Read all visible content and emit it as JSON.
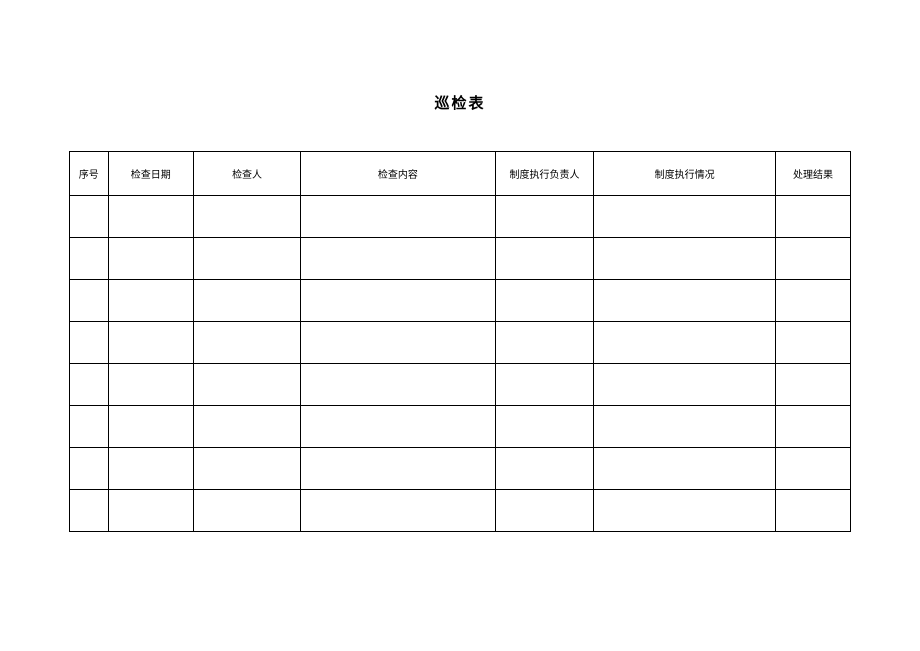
{
  "title": "巡检表",
  "columns": [
    "序号",
    "检查日期",
    "检查人",
    "检查内容",
    "制度执行负责人",
    "制度执行情况",
    "处理结果"
  ],
  "rows": [
    [
      "",
      "",
      "",
      "",
      "",
      "",
      ""
    ],
    [
      "",
      "",
      "",
      "",
      "",
      "",
      ""
    ],
    [
      "",
      "",
      "",
      "",
      "",
      "",
      ""
    ],
    [
      "",
      "",
      "",
      "",
      "",
      "",
      ""
    ],
    [
      "",
      "",
      "",
      "",
      "",
      "",
      ""
    ],
    [
      "",
      "",
      "",
      "",
      "",
      "",
      ""
    ],
    [
      "",
      "",
      "",
      "",
      "",
      "",
      ""
    ],
    [
      "",
      "",
      "",
      "",
      "",
      "",
      ""
    ]
  ]
}
